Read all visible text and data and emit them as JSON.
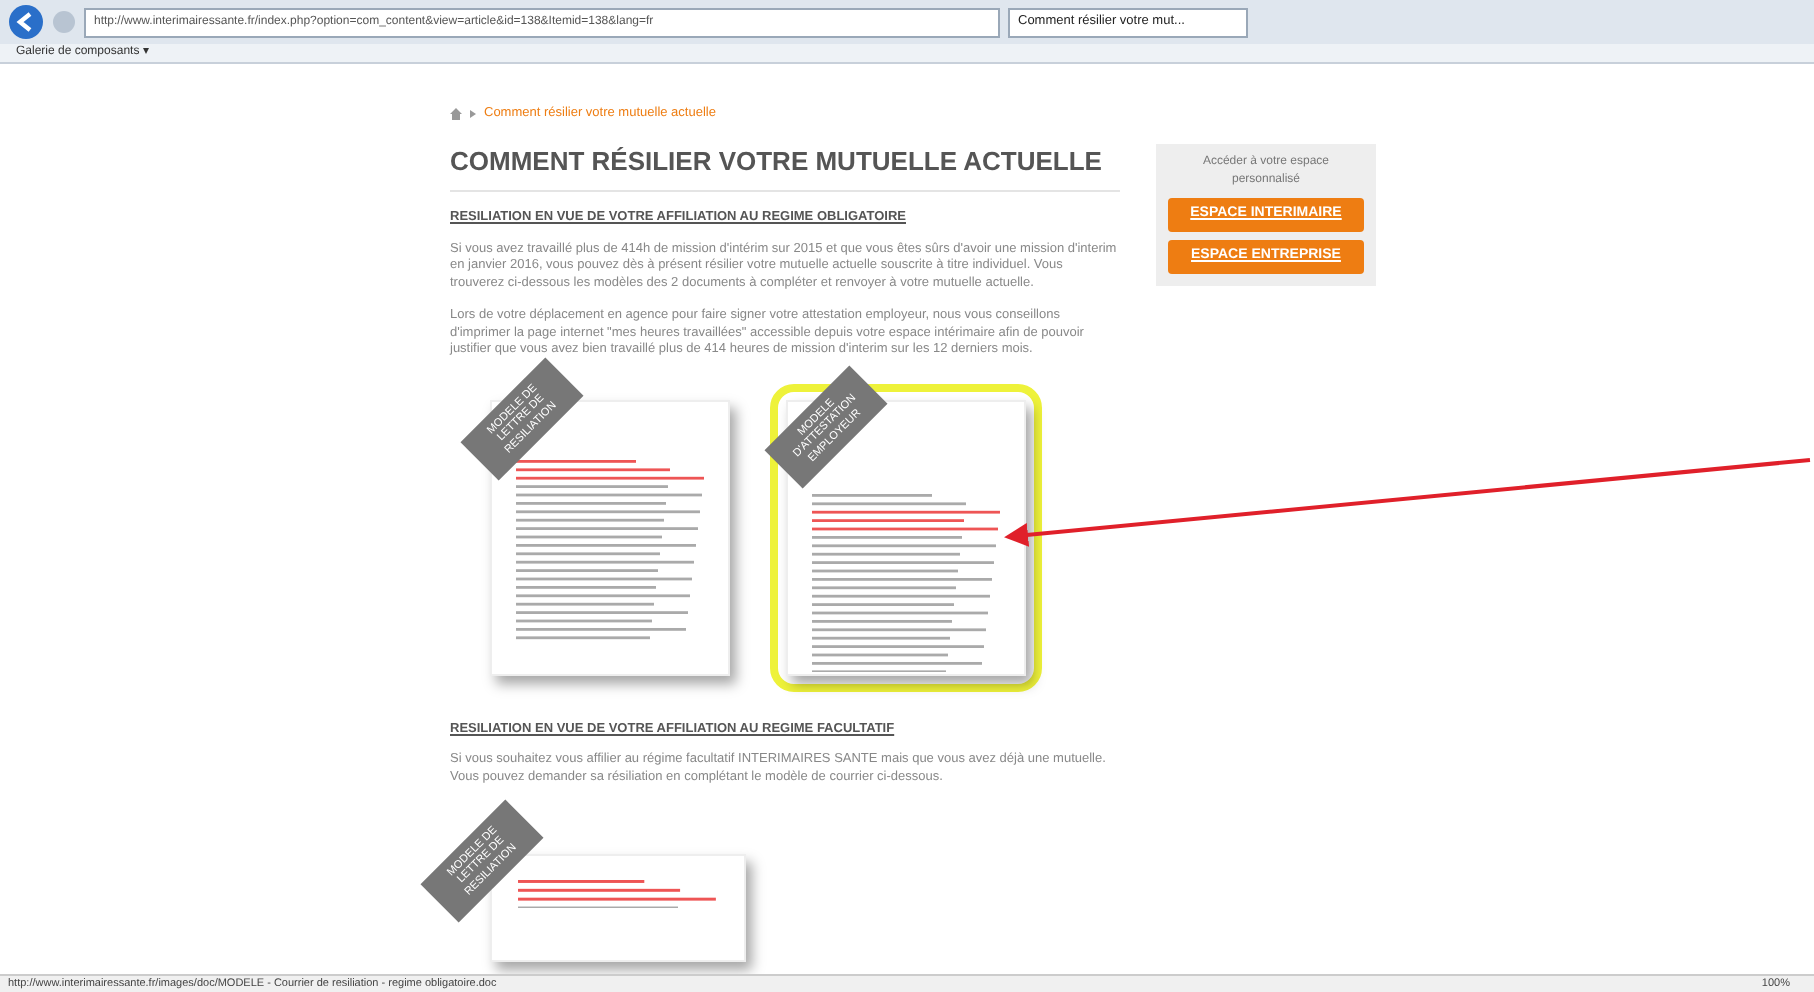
{
  "browser": {
    "address": "http://www.interimairessante.fr/index.php?option=com_content&view=article&id=138&Itemid=138&lang=fr",
    "tab_title": "Comment résilier votre mut...",
    "favorites": [
      "Galerie de composants ▾"
    ]
  },
  "breadcrumb": "Comment résilier votre mutuelle actuelle",
  "title": "COMMENT RÉSILIER VOTRE MUTUELLE ACTUELLE",
  "sections": [
    {
      "heading": "RESILIATION EN VUE DE VOTRE AFFILIATION AU REGIME OBLIGATOIRE",
      "paragraphs": [
        "Si vous avez travaillé plus de 414h de mission d'intérim sur 2015 et que vous êtes sûrs d'avoir une mission d'interim en janvier 2016, vous pouvez dès à présent résilier votre mutuelle actuelle souscrite à titre individuel. Vous trouverez ci-dessous les modèles des 2 documents à compléter et renvoyer à votre mutuelle actuelle.",
        "Lors de votre déplacement en agence pour faire signer votre attestation employeur, nous vous conseillons d'imprimer la page internet \"mes heures travaillées\" accessible depuis votre espace intérimaire afin de pouvoir justifier que vous avez bien travaillé plus de 414 heures de mission d'interim sur les 12 derniers mois."
      ],
      "documents": [
        {
          "ribbon": "MODELE DE LETTRE DE RESILIATION",
          "highlighted": false
        },
        {
          "ribbon": "MODELE D'ATTESTATION EMPLOYEUR",
          "highlighted": true
        }
      ]
    },
    {
      "heading": "RESILIATION EN VUE DE VOTRE AFFILIATION AU REGIME FACULTATIF",
      "paragraphs": [
        "Si vous souhaitez vous affilier au régime facultatif INTERIMAIRES SANTE mais que vous avez déjà une mutuelle. Vous pouvez demander sa résiliation en complétant le modèle de courrier ci-dessous."
      ],
      "documents": [
        {
          "ribbon": "MODELE DE LETTRE DE RESILIATION",
          "highlighted": false
        }
      ]
    }
  ],
  "sidebar": {
    "text": "Accéder à votre espace personnalisé",
    "buttons": [
      "ESPACE INTERIMAIRE",
      "ESPACE ENTREPRISE"
    ]
  },
  "status_bar": {
    "url": "http://www.interimairessante.fr/images/doc/MODELE - Courrier de resiliation - regime obligatoire.doc",
    "zoom": "100%"
  }
}
